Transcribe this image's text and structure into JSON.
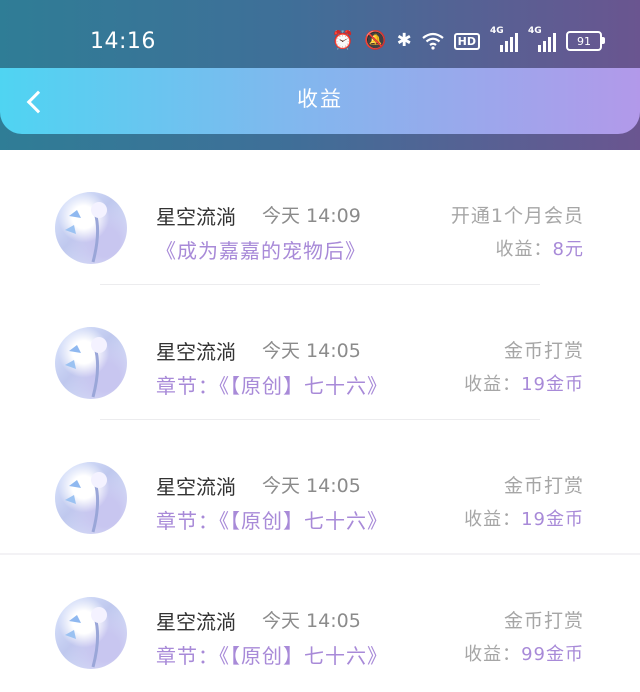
{
  "status_bar": {
    "time": "14:16",
    "icons": [
      "alarm-icon",
      "bell-off-icon",
      "bluetooth-icon",
      "wifi-icon",
      "hd-icon",
      "signal-4g-icon",
      "signal-4g-icon",
      "battery-icon"
    ],
    "hd_label": "HD",
    "net1_label": "4G",
    "net2_label": "4G",
    "battery": "91"
  },
  "header": {
    "title": "收益",
    "back_icon": "chevron-left-icon"
  },
  "colors": {
    "accent": "#a88ad8",
    "header_start": "#4fd4f2",
    "header_end": "#b299ea"
  },
  "records": [
    {
      "name": "星空流淌",
      "time": "今天 14:09",
      "work": "《成为嘉嘉的宠物后》",
      "type": "开通1个月会员",
      "earn_label": "收益：",
      "earn_value": "8元"
    },
    {
      "name": "星空流淌",
      "time": "今天 14:05",
      "work": "章节：《【原创】七十六》",
      "type": "金币打赏",
      "earn_label": "收益：",
      "earn_value": "19金币"
    },
    {
      "name": "星空流淌",
      "time": "今天 14:05",
      "work": "章节：《【原创】七十六》",
      "type": "金币打赏",
      "earn_label": "收益：",
      "earn_value": "19金币"
    },
    {
      "name": "星空流淌",
      "time": "今天 14:05",
      "work": "章节：《【原创】七十六》",
      "type": "金币打赏",
      "earn_label": "收益：",
      "earn_value": "99金币"
    }
  ]
}
